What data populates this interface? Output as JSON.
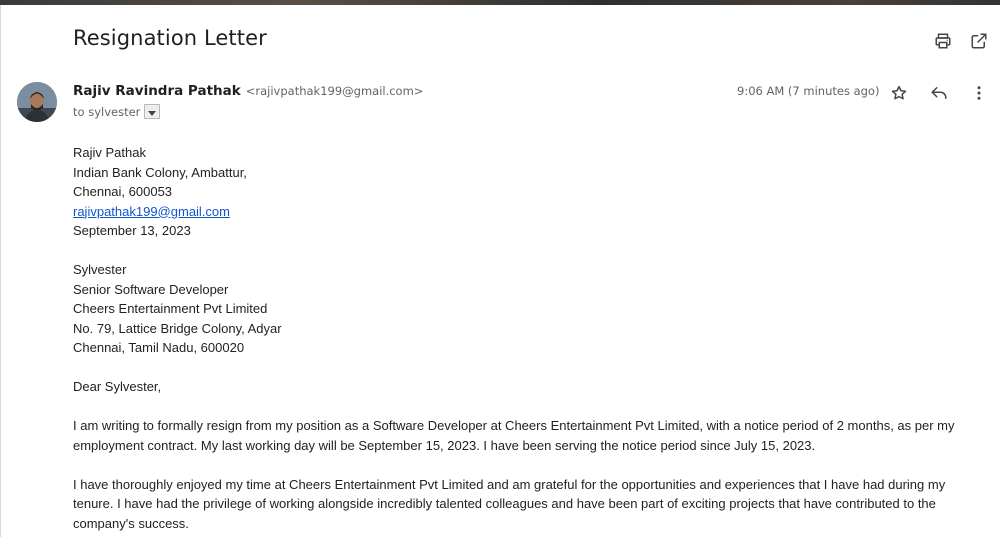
{
  "email": {
    "subject": "Resignation Letter",
    "sender": {
      "name": "Rajiv Ravindra Pathak",
      "email": "<rajivpathak199@gmail.com>"
    },
    "recipient_text": "to sylvester",
    "timestamp": "9:06 AM (7 minutes ago)"
  },
  "icons": {
    "header": [
      "print-icon",
      "open-in-new-window-icon"
    ],
    "message": [
      "star-icon",
      "reply-icon",
      "more-options-icon"
    ],
    "recipient": "dropdown-arrow-icon"
  },
  "letter": {
    "sender_block": {
      "name": "Rajiv Pathak",
      "address_line1": "Indian Bank Colony, Ambattur,",
      "address_line2": "Chennai, 600053",
      "email_link": "rajivpathak199@gmail.com",
      "date": "September 13, 2023"
    },
    "recipient_block": {
      "name": "Sylvester",
      "title": "Senior Software Developer",
      "company": "Cheers Entertainment Pvt Limited",
      "address_line1": "No. 79, Lattice Bridge Colony, Adyar",
      "address_line2": "Chennai, Tamil Nadu, 600020"
    },
    "salutation": "Dear Sylvester,",
    "paragraph1_line1": "I am writing to formally resign from my position as a Software Developer at Cheers Entertainment Pvt Limited, with a notice period of 2 months, as per my",
    "paragraph1_line2": "employment contract. My last working day will be September 15, 2023. I have been serving the notice period since July 15, 2023.",
    "paragraph2_line1": "I have thoroughly enjoyed my time at Cheers Entertainment Pvt Limited and am grateful for the opportunities and experiences that I have had during my",
    "paragraph2_line2": "tenure. I have had the privilege of working alongside incredibly talented colleagues and have been part of exciting projects that have contributed to the",
    "paragraph2_line3": "company's success."
  },
  "colors": {
    "link": "#1155cc",
    "muted_text": "#5f6368",
    "body_text": "#222222"
  }
}
